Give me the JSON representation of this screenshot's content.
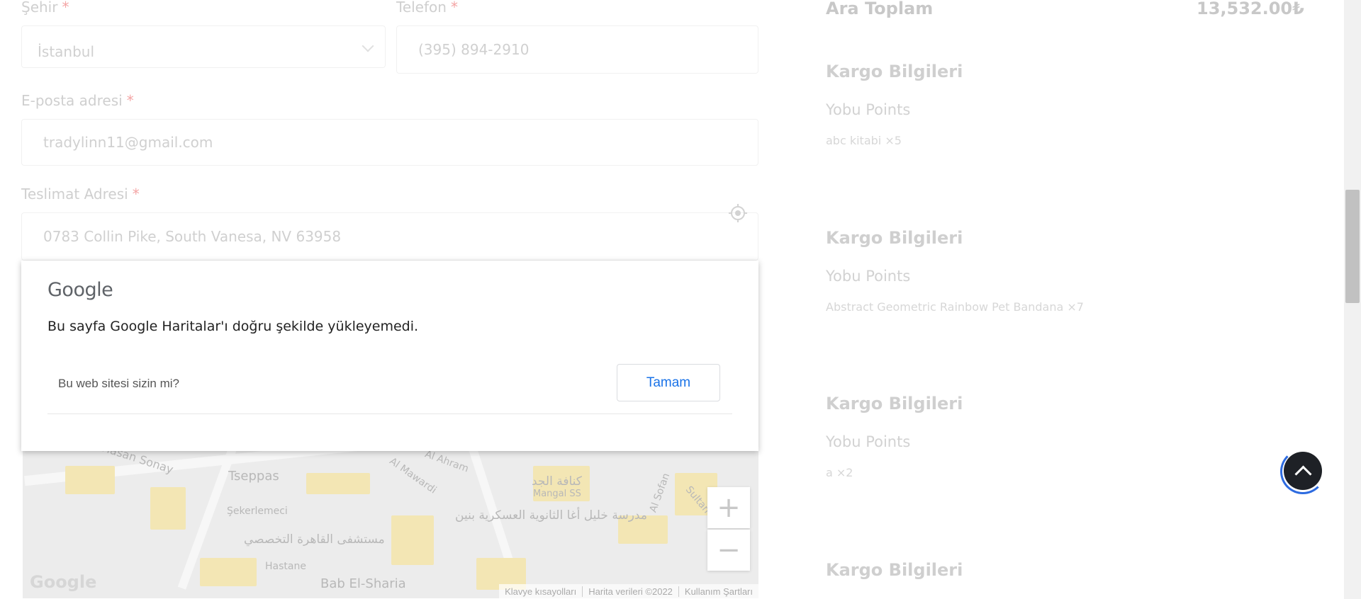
{
  "form": {
    "city": {
      "label": "Şehir",
      "required_mark": "*",
      "value": "İstanbul"
    },
    "phone": {
      "label": "Telefon",
      "required_mark": "*",
      "value": "(395) 894-2910"
    },
    "email": {
      "label": "E-posta adresi",
      "required_mark": "*",
      "value": "tradylinn11@gmail.com"
    },
    "address": {
      "label": "Teslimat Adresi",
      "required_mark": "*",
      "value": "0783 Collin Pike, South Vanesa, NV 63958"
    }
  },
  "map_error_dialog": {
    "logo": "Google",
    "message": "Bu sayfa Google Haritalar'ı doğru şekilde yükleyemedi.",
    "question": "Bu web sitesi sizin mi?",
    "ok_button": "Tamam"
  },
  "map": {
    "labels": [
      "Hasan Sonay",
      "Tseppas",
      "Şekerlemeci",
      "Hastane",
      "Bab El-Sharia",
      "Mangal SS",
      "Al Sofan",
      "Al Mawardi",
      "Al Ahram",
      "Sultan"
    ],
    "arabic_labels": [
      "مستشفى القاهرة التخصصي",
      "مدرسة خليل أغا الثانوية العسكرية بنين",
      "كنافة الجد"
    ],
    "zoom_in": "+",
    "zoom_out": "−",
    "watermark": "Google",
    "footer": [
      "Klavye kısayolları",
      "Harita verileri ©2022",
      "Kullanım Şartları"
    ]
  },
  "summary": {
    "subtotal_label": "Ara Toplam",
    "subtotal_value": "13,532.00₺",
    "sections": [
      {
        "title": "Kargo Bilgileri",
        "subtitle": "Yobu Points",
        "item": "abc kitabi ×5"
      },
      {
        "title": "Kargo Bilgileri",
        "subtitle": "Yobu Points",
        "item": "Abstract Geometric Rainbow Pet Bandana ×7"
      },
      {
        "title": "Kargo Bilgileri",
        "subtitle": "Yobu Points",
        "item": "a ×2"
      },
      {
        "title": "Kargo Bilgileri"
      }
    ]
  },
  "icons": {
    "location": "crosshair-location-icon",
    "scroll_top": "arrow-up-icon",
    "dropdown": "chevron-down-icon"
  }
}
